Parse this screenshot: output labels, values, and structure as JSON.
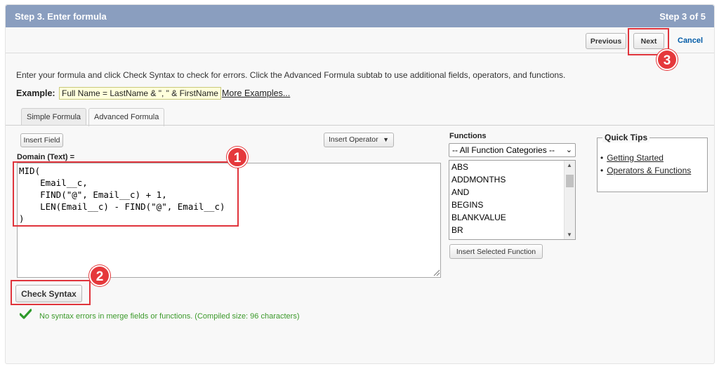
{
  "header": {
    "title": "Step 3. Enter formula",
    "step": "Step 3 of 5"
  },
  "nav": {
    "previous": "Previous",
    "next": "Next",
    "cancel": "Cancel"
  },
  "instructions": "Enter your formula and click Check Syntax to check for errors. Click the Advanced Formula subtab to use additional fields, operators, and functions.",
  "example": {
    "label": "Example:",
    "formula": "Full Name = LastName & \", \" & FirstName",
    "more": "More Examples..."
  },
  "tabs": [
    {
      "label": "Simple Formula"
    },
    {
      "label": "Advanced Formula"
    }
  ],
  "editor": {
    "insert_field": "Insert Field",
    "insert_operator": "Insert Operator",
    "field_label": "Domain (Text) =",
    "formula": "MID(\n    Email__c,\n    FIND(\"@\", Email__c) + 1,\n    LEN(Email__c) - FIND(\"@\", Email__c)\n)"
  },
  "functions": {
    "label": "Functions",
    "category": "-- All Function Categories --",
    "items": [
      "ABS",
      "ADDMONTHS",
      "AND",
      "BEGINS",
      "BLANKVALUE",
      "BR"
    ],
    "insert": "Insert Selected Function"
  },
  "quick_tips": {
    "title": "Quick Tips",
    "links": [
      "Getting Started",
      "Operators & Functions"
    ]
  },
  "check_syntax": "Check Syntax",
  "status": {
    "message": "No syntax errors in merge fields or functions. (Compiled size: 96 characters)",
    "color": "#3c9a2b"
  },
  "callouts": [
    "1",
    "2",
    "3"
  ],
  "colors": {
    "header": "#8a9ebf",
    "highlight": "#e0343c",
    "link": "#015ba7"
  }
}
